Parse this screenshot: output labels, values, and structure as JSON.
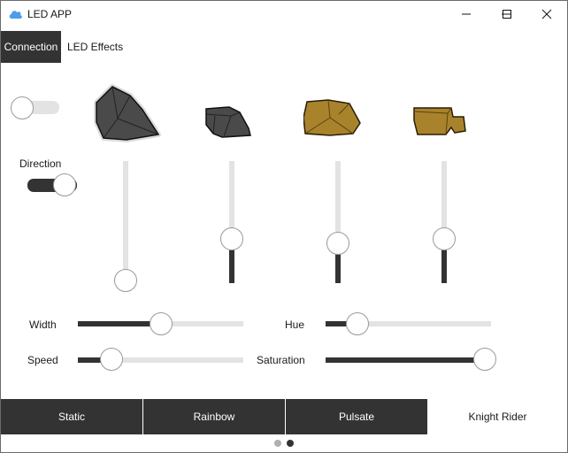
{
  "window": {
    "title": "LED APP",
    "app_icon": "cloud-icon",
    "controls": [
      "minimize-icon",
      "maximize-icon",
      "close-icon"
    ]
  },
  "tabs": [
    {
      "label": "Connection",
      "active": true
    },
    {
      "label": "LED Effects",
      "active": false
    }
  ],
  "power_switch": {
    "on": false
  },
  "direction": {
    "label": "Direction",
    "on": true
  },
  "colors": {
    "accent": "#333333",
    "track": "#e3e3e3"
  },
  "channels": [
    {
      "icon": "dark-rock-icon",
      "level": 0.0
    },
    {
      "icon": "small-dark-rock-icon",
      "level": 0.35
    },
    {
      "icon": "gold-rock-icon",
      "level": 0.31
    },
    {
      "icon": "gold-block-icon",
      "level": 0.35
    }
  ],
  "sliders": {
    "width": {
      "label": "Width",
      "level": 0.5
    },
    "hue": {
      "label": "Hue",
      "level": 0.17
    },
    "speed": {
      "label": "Speed",
      "level": 0.18
    },
    "saturation": {
      "label": "Saturation",
      "level": 1.0
    }
  },
  "effects": [
    {
      "label": "Static",
      "selected": false
    },
    {
      "label": "Rainbow",
      "selected": false
    },
    {
      "label": "Pulsate",
      "selected": false
    },
    {
      "label": "Knight Rider",
      "selected": true
    }
  ],
  "pager": {
    "pages": 2,
    "current": 2
  }
}
